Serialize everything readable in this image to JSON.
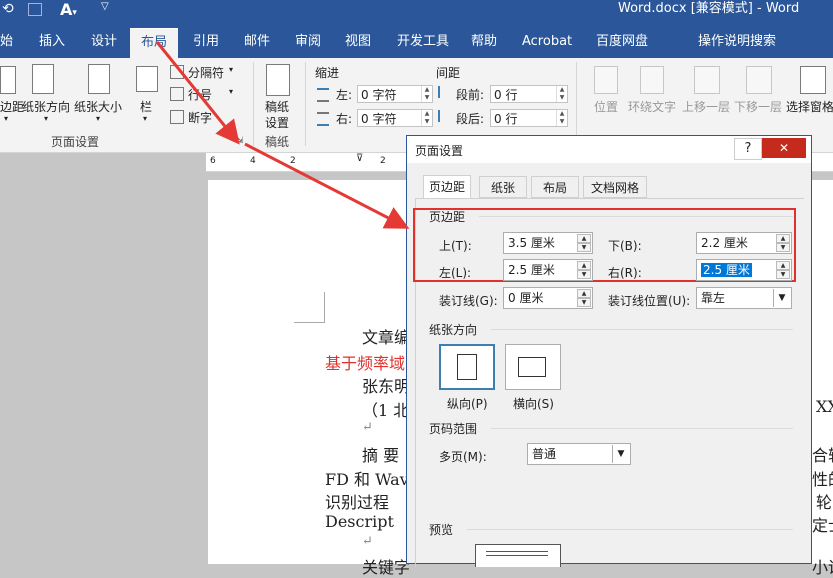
{
  "window": {
    "title": "Word.docx [兼容模式] - Word"
  },
  "tabs": [
    "始",
    "插入",
    "设计",
    "布局",
    "引用",
    "邮件",
    "审阅",
    "视图",
    "开发工具",
    "帮助",
    "Acrobat",
    "百度网盘"
  ],
  "tell_me": "操作说明搜索",
  "ribbon": {
    "page_setup": {
      "margins_label": "边距",
      "orientation_label": "纸张方向",
      "size_label": "纸张大小",
      "columns_label": "栏",
      "breaks_label": "分隔符",
      "line_numbers_label": "行号",
      "hyphenation_label": "断字",
      "group_label": "页面设置"
    },
    "draft_paper": {
      "label_line1": "稿纸",
      "label_line2": "设置",
      "group_label": "稿纸"
    },
    "paragraph": {
      "indent_header": "缩进",
      "spacing_header": "间距",
      "left_label": "左:",
      "left_value": "0 字符",
      "right_label": "右:",
      "right_value": "0 字符",
      "before_label": "段前:",
      "before_value": "0 行",
      "after_label": "段后:",
      "after_value": "0 行"
    },
    "arrange": {
      "position": "位置",
      "wrap_text": "环绕文字",
      "bring_forward": "上移一层",
      "send_backward": "下移一层",
      "selection_pane": "选择窗格"
    }
  },
  "ruler": {
    "numbers": [
      "6",
      "4",
      "2",
      "2"
    ]
  },
  "document": {
    "line1": "文章编",
    "line2": "基于频率域",
    "line3": "张东明",
    "line4": "（1 北",
    "line5a": "摘   要",
    "line6": "FD 和 Wav",
    "line7": "识别过程",
    "line8": "Descript",
    "line9": "关键字",
    "right_fragments": [
      "XX",
      "合轴",
      "性的",
      "轮",
      "定士",
      "小说"
    ],
    "return_mark": "↵"
  },
  "dialog": {
    "title": "页面设置",
    "help": "?",
    "close": "✕",
    "tabs": [
      "页边距",
      "纸张",
      "布局",
      "文档网格"
    ],
    "margins_group": "页边距",
    "top_label": "上(T):",
    "top_value": "3.5 厘米",
    "bottom_label": "下(B):",
    "bottom_value": "2.2 厘米",
    "left_label": "左(L):",
    "left_value": "2.5 厘米",
    "right_label": "右(R):",
    "right_value": "2.5 厘米",
    "gutter_label": "装订线(G):",
    "gutter_value": "0 厘米",
    "gutter_pos_label": "装订线位置(U):",
    "gutter_pos_value": "靠左",
    "orientation_group": "纸张方向",
    "portrait": "纵向(P)",
    "landscape": "横向(S)",
    "pages_group": "页码范围",
    "multiple_pages_label": "多页(M):",
    "multiple_pages_value": "普通",
    "preview_group": "预览"
  },
  "colors": {
    "accent": "#2b579a",
    "highlight_box": "#e0312c",
    "arrow": "#e53935",
    "heading_red": "#e0312c"
  }
}
